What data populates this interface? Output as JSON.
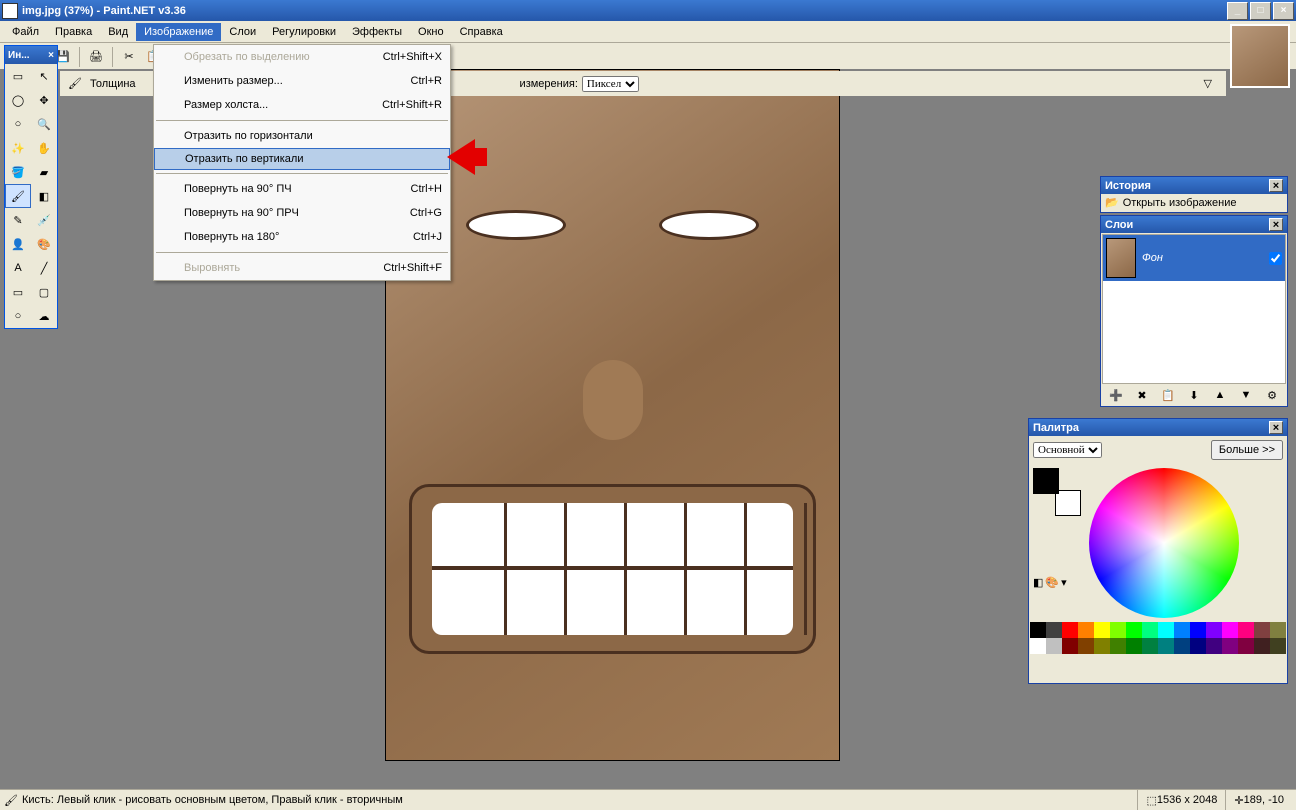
{
  "window": {
    "title": "img.jpg (37%) - Paint.NET v3.36"
  },
  "menu": {
    "items": [
      "Файл",
      "Правка",
      "Вид",
      "Изображение",
      "Слои",
      "Регулировки",
      "Эффекты",
      "Окно",
      "Справка"
    ],
    "open_index": 3
  },
  "dropdown": [
    {
      "label": "Обрезать по выделению",
      "shortcut": "Ctrl+Shift+X",
      "disabled": true
    },
    {
      "label": "Изменить размер...",
      "shortcut": "Ctrl+R"
    },
    {
      "label": "Размер холста...",
      "shortcut": "Ctrl+Shift+R"
    },
    {
      "sep": true
    },
    {
      "label": "Отразить по горизонтали",
      "shortcut": ""
    },
    {
      "label": "Отразить по вертикали",
      "shortcut": "",
      "highlighted": true
    },
    {
      "sep": true
    },
    {
      "label": "Повернуть на 90° ПЧ",
      "shortcut": "Ctrl+H"
    },
    {
      "label": "Повернуть на 90° ПРЧ",
      "shortcut": "Ctrl+G"
    },
    {
      "label": "Повернуть на 180°",
      "shortcut": "Ctrl+J"
    },
    {
      "sep": true
    },
    {
      "label": "Выровнять",
      "shortcut": "Ctrl+Shift+F",
      "disabled": true
    }
  ],
  "subtoolbar": {
    "thickness_label": "Толщина",
    "units_label": "измерения:",
    "units_value": "Пиксел"
  },
  "toolbox": {
    "title": "Ин..."
  },
  "history": {
    "title": "История",
    "item": "Открыть изображение"
  },
  "layers": {
    "title": "Слои",
    "layer_name": "Фон"
  },
  "palette": {
    "title": "Палитра",
    "mode": "Основной",
    "more": "Больше >>",
    "swatches": [
      "#000",
      "#404040",
      "#f00",
      "#ff8000",
      "#ff0",
      "#80ff00",
      "#0f0",
      "#00ff80",
      "#0ff",
      "#0080ff",
      "#00f",
      "#8000ff",
      "#f0f",
      "#ff0080",
      "#804040",
      "#808040",
      "#fff",
      "#c0c0c0",
      "#800000",
      "#804000",
      "#808000",
      "#408000",
      "#008000",
      "#008040",
      "#008080",
      "#004080",
      "#000080",
      "#400080",
      "#800080",
      "#800040",
      "#402020",
      "#404020"
    ]
  },
  "status": {
    "hint": "Кисть: Левый клик - рисовать основным цветом, Правый клик - вторичным",
    "size": "1536 x 2048",
    "coords": "189, -10"
  }
}
